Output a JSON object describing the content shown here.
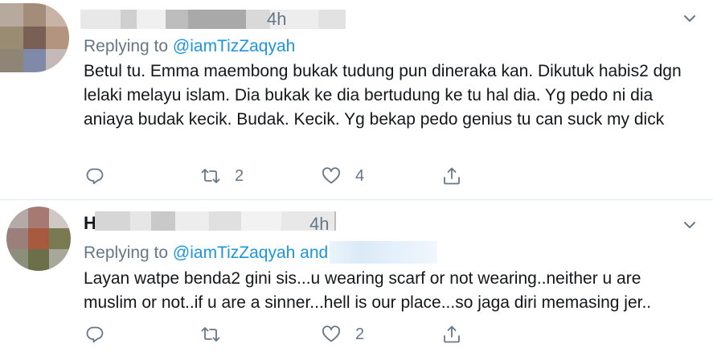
{
  "tweets": [
    {
      "name_initial": "",
      "time": "4h",
      "replying_prefix": "Replying to",
      "mention": "@iamTizZaqyah",
      "mention_joiner": "",
      "text": "Betul tu. Emma maembong bukak tudung pun dineraka kan. Dikutuk habis2 dgn lelaki melayu islam. Dia bukak ke dia bertudung ke tu hal dia. Yg pedo ni dia aniaya budak kecik. Budak. Kecik. Yg bekap pedo genius tu can suck my dick",
      "retweets": "2",
      "likes": "4",
      "avatar_colors": [
        "#b8a99e",
        "#a48c7a",
        "#c9b3a6",
        "#9a8b73",
        "#7a5f54",
        "#b3947f",
        "#8e8577",
        "#7e8aa8",
        "#c5b9b7"
      ]
    },
    {
      "name_initial": "H",
      "time": "4h",
      "replying_prefix": "Replying to",
      "mention": "@iamTizZaqyah",
      "mention_joiner": "and",
      "text": "Layan watpe benda2 gini sis...u wearing scarf or not wearing..neither u are muslim or not..if u are a sinner...hell is our place...so jaga diri memasing jer..",
      "retweets": "",
      "likes": "2",
      "avatar_colors": [
        "#b4aba8",
        "#a67a72",
        "#cfc8c4",
        "#9a7f7a",
        "#a85a3e",
        "#7a7a52",
        "#8c8f7c",
        "#6d6f48",
        "#a8a89a"
      ]
    }
  ],
  "colors": {
    "link": "#1b95e0",
    "muted": "#657786",
    "text": "#14171a"
  }
}
